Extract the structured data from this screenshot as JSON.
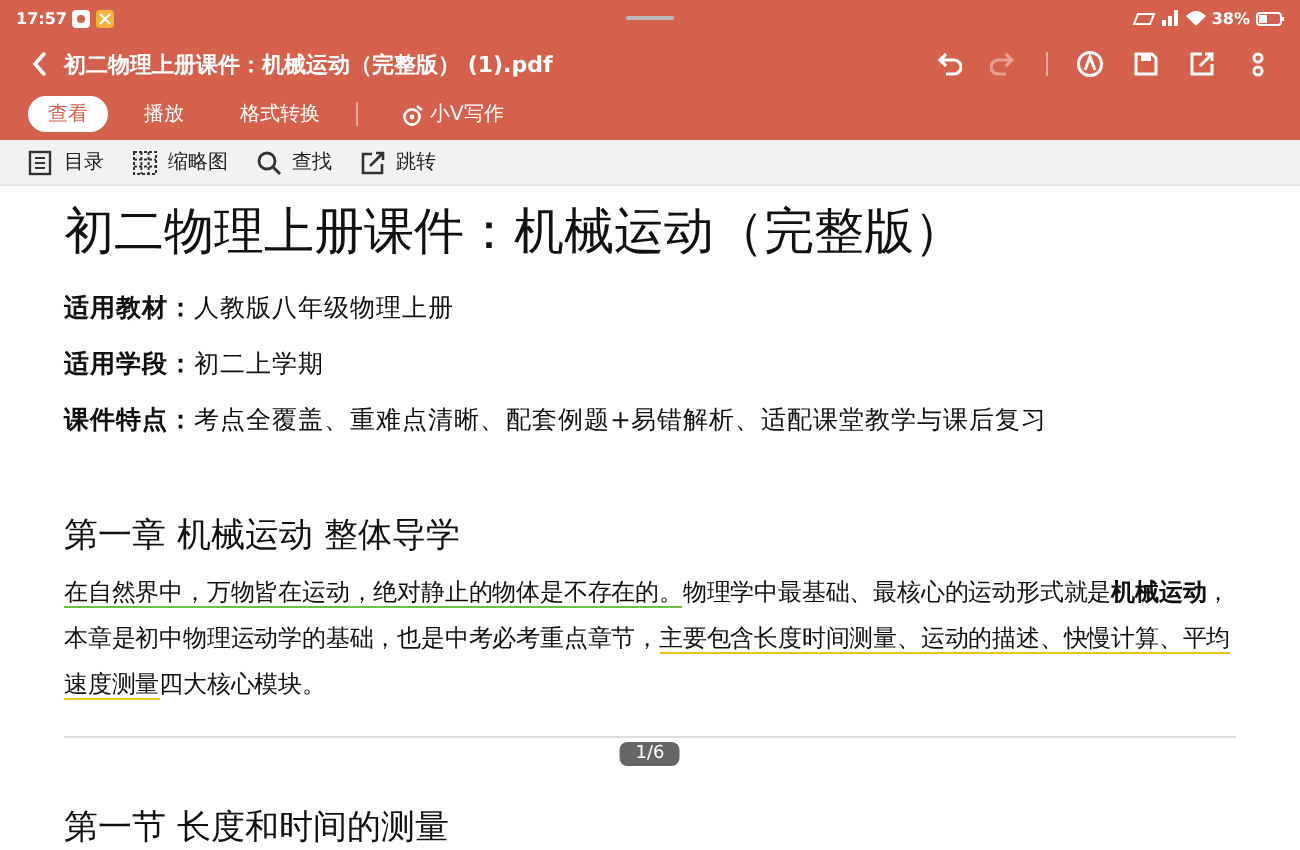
{
  "status_bar": {
    "time": "17:57",
    "battery": "38%"
  },
  "header": {
    "title": "初二物理上册课件：机械运动（完整版） (1).pdf",
    "tabs": [
      {
        "label": "查看",
        "selected": true
      },
      {
        "label": "播放",
        "selected": false
      },
      {
        "label": "格式转换",
        "selected": false
      }
    ],
    "assistant": "小V写作",
    "actions": [
      {
        "kind": "undo",
        "disabled": false
      },
      {
        "kind": "redo",
        "disabled": true
      },
      {
        "kind": "annotate",
        "disabled": false
      },
      {
        "kind": "save",
        "disabled": false
      },
      {
        "kind": "share",
        "disabled": false
      },
      {
        "kind": "more",
        "disabled": false
      }
    ]
  },
  "toolbar": [
    {
      "kind": "toc",
      "label": "目录"
    },
    {
      "kind": "thumbs",
      "label": "缩略图"
    },
    {
      "kind": "search",
      "label": "查找"
    },
    {
      "kind": "jump",
      "label": "跳转"
    }
  ],
  "document": {
    "title": "初二物理上册课件：机械运动（完整版）",
    "info": [
      "**适用教材：**人教版八年级物理上册",
      "**适用学段：**初二上学期",
      "**课件特点：**考点全覆盖、重难点清晰、配套例题+易错解析、适配课堂教学与课后复习"
    ],
    "chapter": "第一章 机械运动 整体导学",
    "paragraph": [
      {
        "text": "在自然界中，万物皆在运动，绝对静止的物体是不存在的。",
        "color": "#6cc04a"
      },
      {
        "text": "物理学中最基础、最核心的运动形式就是**机械运动**，本章是初中物理运动学的基础，也是中考必考重点章节，"
      },
      {
        "text": "主要包含长度时间测量、运动的描述、快慢计算、平均速度测量",
        "color": "#f2c21b"
      },
      {
        "text": "四大核心模块。"
      }
    ],
    "page_indicator": "1/6",
    "next_heading": "第一节 长度和时间的测量"
  }
}
